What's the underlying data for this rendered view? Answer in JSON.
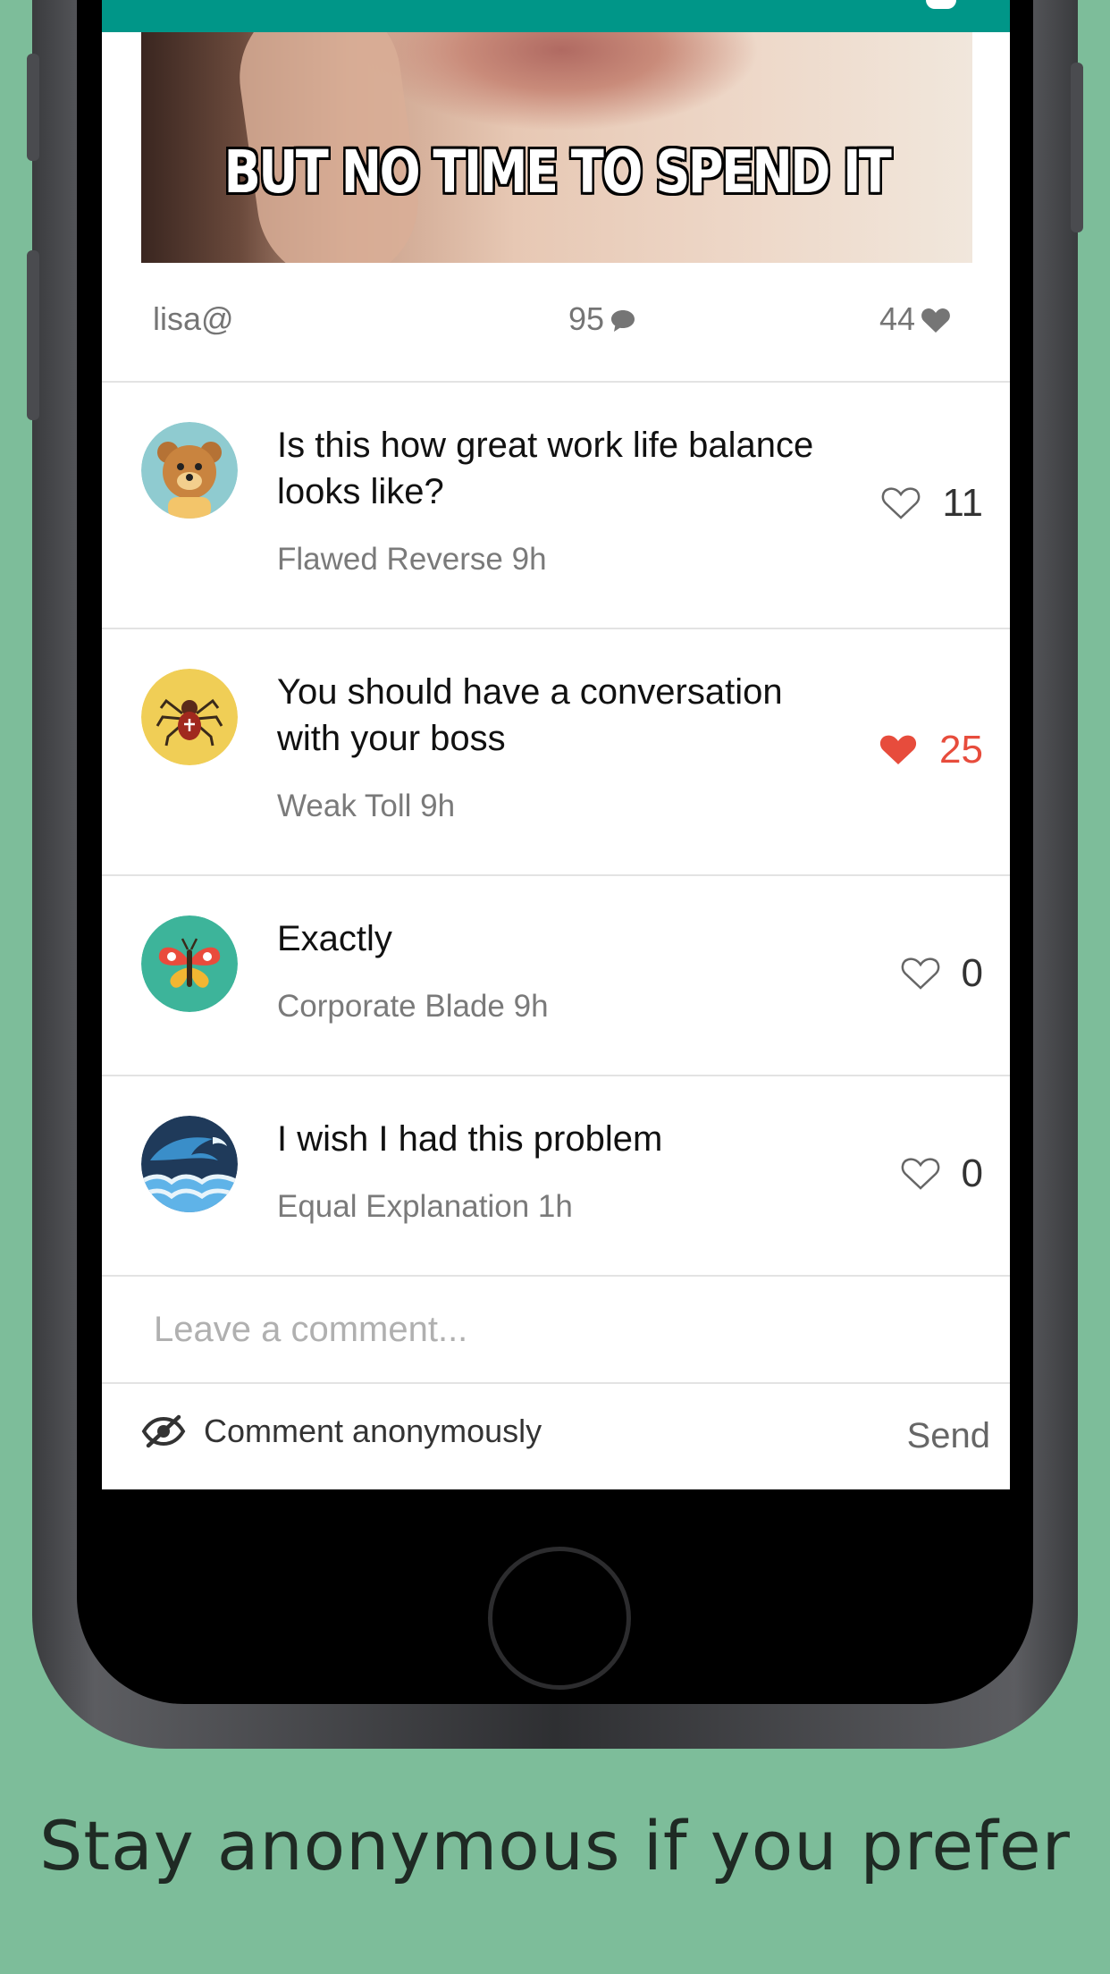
{
  "post": {
    "meme_caption": "BUT NO TIME TO SPEND IT",
    "author": "lisa@",
    "comment_count": "95",
    "like_count": "44"
  },
  "comments": [
    {
      "text": "Is this how great work life balance looks like?",
      "meta": "Flawed Reverse 9h",
      "likes": "11",
      "liked": false,
      "avatar": "bear-icon"
    },
    {
      "text": "You should have a conversation with your boss",
      "meta": "Weak Toll 9h",
      "likes": "25",
      "liked": true,
      "avatar": "spider-icon"
    },
    {
      "text": "Exactly",
      "meta": "Corporate Blade 9h",
      "likes": "0",
      "liked": false,
      "avatar": "butterfly-icon"
    },
    {
      "text": "I wish I had this problem",
      "meta": "Equal Explanation 1h",
      "likes": "0",
      "liked": false,
      "avatar": "wave-icon"
    }
  ],
  "composer": {
    "placeholder": "Leave a comment...",
    "anonymous_label": "Comment anonymously",
    "send_label": "Send"
  },
  "tagline": "Stay anonymous if you prefer",
  "colors": {
    "background": "#7dbd9a",
    "topbar": "#009688",
    "liked": "#e74c3c"
  }
}
